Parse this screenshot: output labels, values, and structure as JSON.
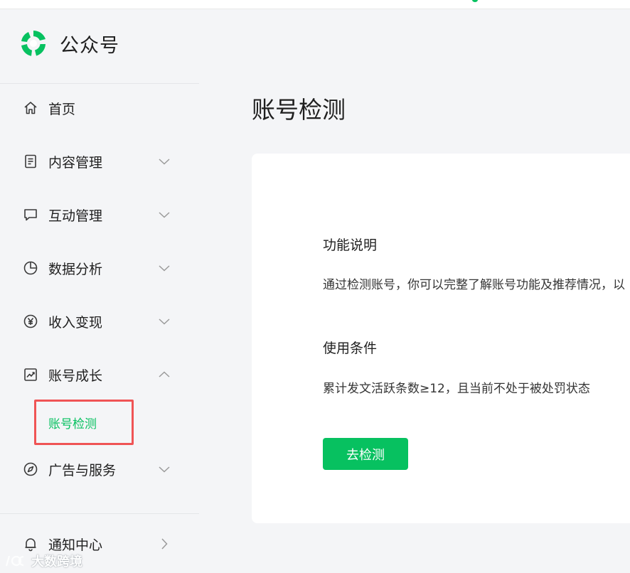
{
  "brand": {
    "name": "公众号",
    "logo_icon": "wechat-official-account-logo-icon",
    "color": "#07c160"
  },
  "sidebar": {
    "items": [
      {
        "label": "首页",
        "icon": "home-icon"
      },
      {
        "label": "内容管理",
        "icon": "document-icon",
        "chevron": "down"
      },
      {
        "label": "互动管理",
        "icon": "chat-bubble-icon",
        "chevron": "down"
      },
      {
        "label": "数据分析",
        "icon": "pie-chart-icon",
        "chevron": "down"
      },
      {
        "label": "收入变现",
        "icon": "yen-circle-icon",
        "chevron": "down"
      },
      {
        "label": "账号成长",
        "icon": "trend-chart-icon",
        "chevron": "up",
        "expanded": true
      },
      {
        "label": "广告与服务",
        "icon": "compass-icon",
        "chevron": "down"
      }
    ],
    "active_sub_item": {
      "label": "账号检测",
      "color": "#07c160"
    },
    "bottom_item": {
      "label": "通知中心",
      "icon": "bell-icon",
      "chevron": "right"
    }
  },
  "main": {
    "title": "账号检测",
    "sections": [
      {
        "title": "功能说明",
        "text": "通过检测账号，你可以完整了解账号功能及推荐情况，以"
      },
      {
        "title": "使用条件",
        "text": "累计发文活跃条数≥12，且当前不处于被处罚状态"
      }
    ],
    "button_label": "去检测"
  },
  "watermark": {
    "text": "大数跨境"
  },
  "colors": {
    "accent": "#07c160",
    "highlight": "#ef5455",
    "background": "#f4f5f7",
    "card": "#ffffff"
  }
}
